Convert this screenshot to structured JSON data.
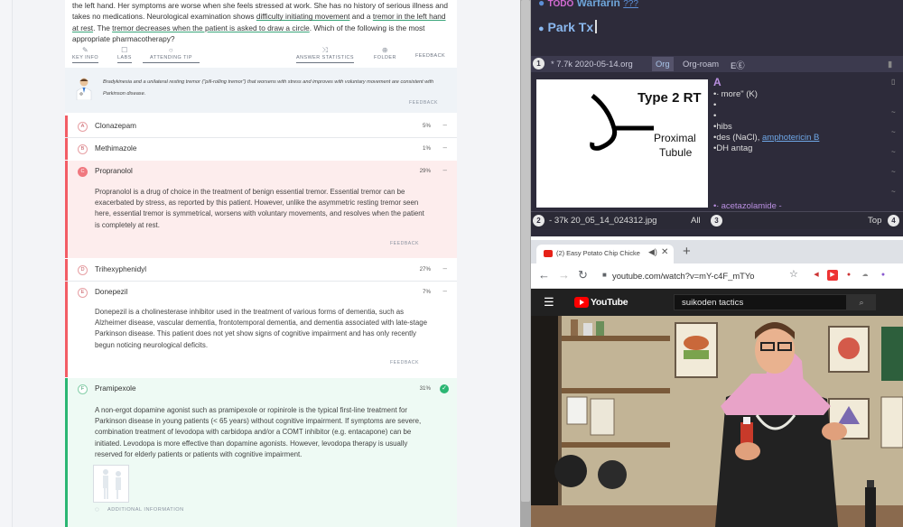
{
  "question": {
    "stem_part1": "the left hand. Her symptoms are worse when she feels stressed at work. She has no history of serious illness and takes no medications. Neurological examination shows ",
    "stem_u1": "difficulty initiating movement",
    "stem_part2": " and a ",
    "stem_u2": "tremor in the left hand at rest",
    "stem_part3": ". The ",
    "stem_u3": "tremor decreases when the patient is asked to draw a circle",
    "stem_part4": ". Which of the following is the most appropriate pharmacotherapy?"
  },
  "toolbar": {
    "key_info": "KEY INFO",
    "labs": "LABS",
    "attending_tip": "ATTENDING TIP",
    "answer_statistics": "ANSWER STATISTICS",
    "folder": "FOLDER",
    "feedback": "FEEDBACK"
  },
  "tip": {
    "text": "Bradykinesia and a unilateral resting tremor (\"pill-rolling tremor\") that worsens with stress and improves with voluntary movement are consistent with Parkinson disease.",
    "feedback": "FEEDBACK"
  },
  "options": [
    {
      "letter": "A",
      "name": "Clonazepam",
      "pct": "5%"
    },
    {
      "letter": "B",
      "name": "Methimazole",
      "pct": "1%"
    },
    {
      "letter": "C",
      "name": "Propranolol",
      "pct": "29%",
      "explanation": "Propranolol is a drug of choice in the treatment of benign essential tremor. Essential tremor can be exacerbated by stress, as reported by this patient. However, unlike the asymmetric resting tremor seen here, essential tremor is symmetrical, worsens with voluntary movements, and resolves when the patient is completely at rest.",
      "feedback": "FEEDBACK"
    },
    {
      "letter": "D",
      "name": "Trihexyphenidyl",
      "pct": "27%"
    },
    {
      "letter": "E",
      "name": "Donepezil",
      "pct": "7%",
      "explanation": "Donepezil is a cholinesterase inhibitor used in the treatment of various forms of dementia, such as Alzheimer disease, vascular dementia, frontotemporal dementia, and dementia associated with late-stage Parkinson disease. This patient does not yet show signs of cognitive impairment and has only recently begun noticing neurological deficits.",
      "feedback": "FEEDBACK"
    },
    {
      "letter": "F",
      "name": "Pramipexole",
      "pct": "31%",
      "explanation": "A non-ergot dopamine agonist such as pramipexole or ropinirole is the typical first-line treatment for Parkinson disease in young patients (< 65 years) without cognitive impairment. If symptoms are severe, combination treatment of levodopa with carbidopa and/or a COMT inhibitor (e.g. entacapone) can be initiated. Levodopa is more effective than dopamine agonists. However, levodopa therapy is usually reserved for elderly patients or patients with cognitive impairment.",
      "additional": "ADDITIONAL INFORMATION"
    }
  ],
  "emacs": {
    "todo_keyword": "TODO",
    "todo_title": "Warfarin",
    "todo_qm": "???",
    "heading": "Park Tx",
    "tab_num": "1",
    "tab_file": "* 7.7k 2020-05-14.org",
    "tab_mode": "Org",
    "tab_minor": "Org-roam",
    "tab_minor_icons": "EⒺ",
    "img_text_title": "Type 2 RT",
    "img_text_prox": "Proximal",
    "img_text_tub": "Tubule",
    "side_lines": [
      "A",
      "•∙ more\" (K)",
      "•",
      "•",
      "•hibs",
      "•des (NaCl), ",
      "•DH antag"
    ],
    "side_link": "amphotericin B",
    "side_acet": "•∙ acetazolamide -",
    "mode_num": "2",
    "mode_text": "- 37k 20_05_14_024312.jpg",
    "mode_all": "All",
    "mode_num3": "3",
    "mode_top": "Top",
    "mode_num4": "4"
  },
  "browser": {
    "tab_title": "(2) Easy Potato Chip Chicke",
    "url": "youtube.com/watch?v=mY-c4F_mTYo",
    "logo": "YouTube",
    "search_text": "suikoden tactics"
  }
}
